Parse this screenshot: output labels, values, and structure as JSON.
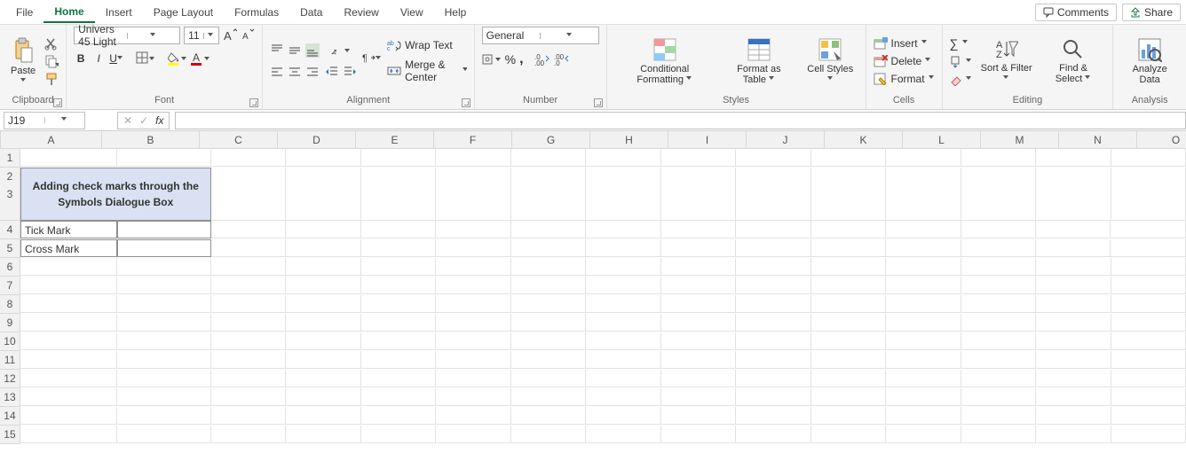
{
  "tabs": {
    "file": "File",
    "home": "Home",
    "insert": "Insert",
    "pageLayout": "Page Layout",
    "formulas": "Formulas",
    "data": "Data",
    "review": "Review",
    "view": "View",
    "help": "Help"
  },
  "topButtons": {
    "comments": "Comments",
    "share": "Share"
  },
  "ribbon": {
    "clipboard": {
      "label": "Clipboard",
      "paste": "Paste"
    },
    "font": {
      "label": "Font",
      "name": "Univers 45 Light",
      "size": "11"
    },
    "alignment": {
      "label": "Alignment",
      "wrap": "Wrap Text",
      "merge": "Merge & Center"
    },
    "number": {
      "label": "Number",
      "format": "General"
    },
    "styles": {
      "label": "Styles",
      "cond": "Conditional Formatting",
      "fat": "Format as Table",
      "cell": "Cell Styles"
    },
    "cells": {
      "label": "Cells",
      "insert": "Insert",
      "delete": "Delete",
      "format": "Format"
    },
    "editing": {
      "label": "Editing",
      "sort": "Sort & Filter",
      "find": "Find & Select"
    },
    "analysis": {
      "label": "Analysis",
      "analyze": "Analyze Data"
    }
  },
  "nameBox": "J19",
  "formula": "",
  "columns": {
    "A": 114,
    "B": 110,
    "C": 88,
    "D": 88,
    "E": 88,
    "F": 88,
    "G": 88,
    "H": 88,
    "I": 88,
    "J": 88,
    "K": 88,
    "L": 88,
    "M": 88,
    "N": 88,
    "O": 88
  },
  "sheet": {
    "mergedHeader": "Adding check marks through the Symbols Dialogue Box",
    "a4": "Tick Mark",
    "a5": "Cross Mark"
  }
}
